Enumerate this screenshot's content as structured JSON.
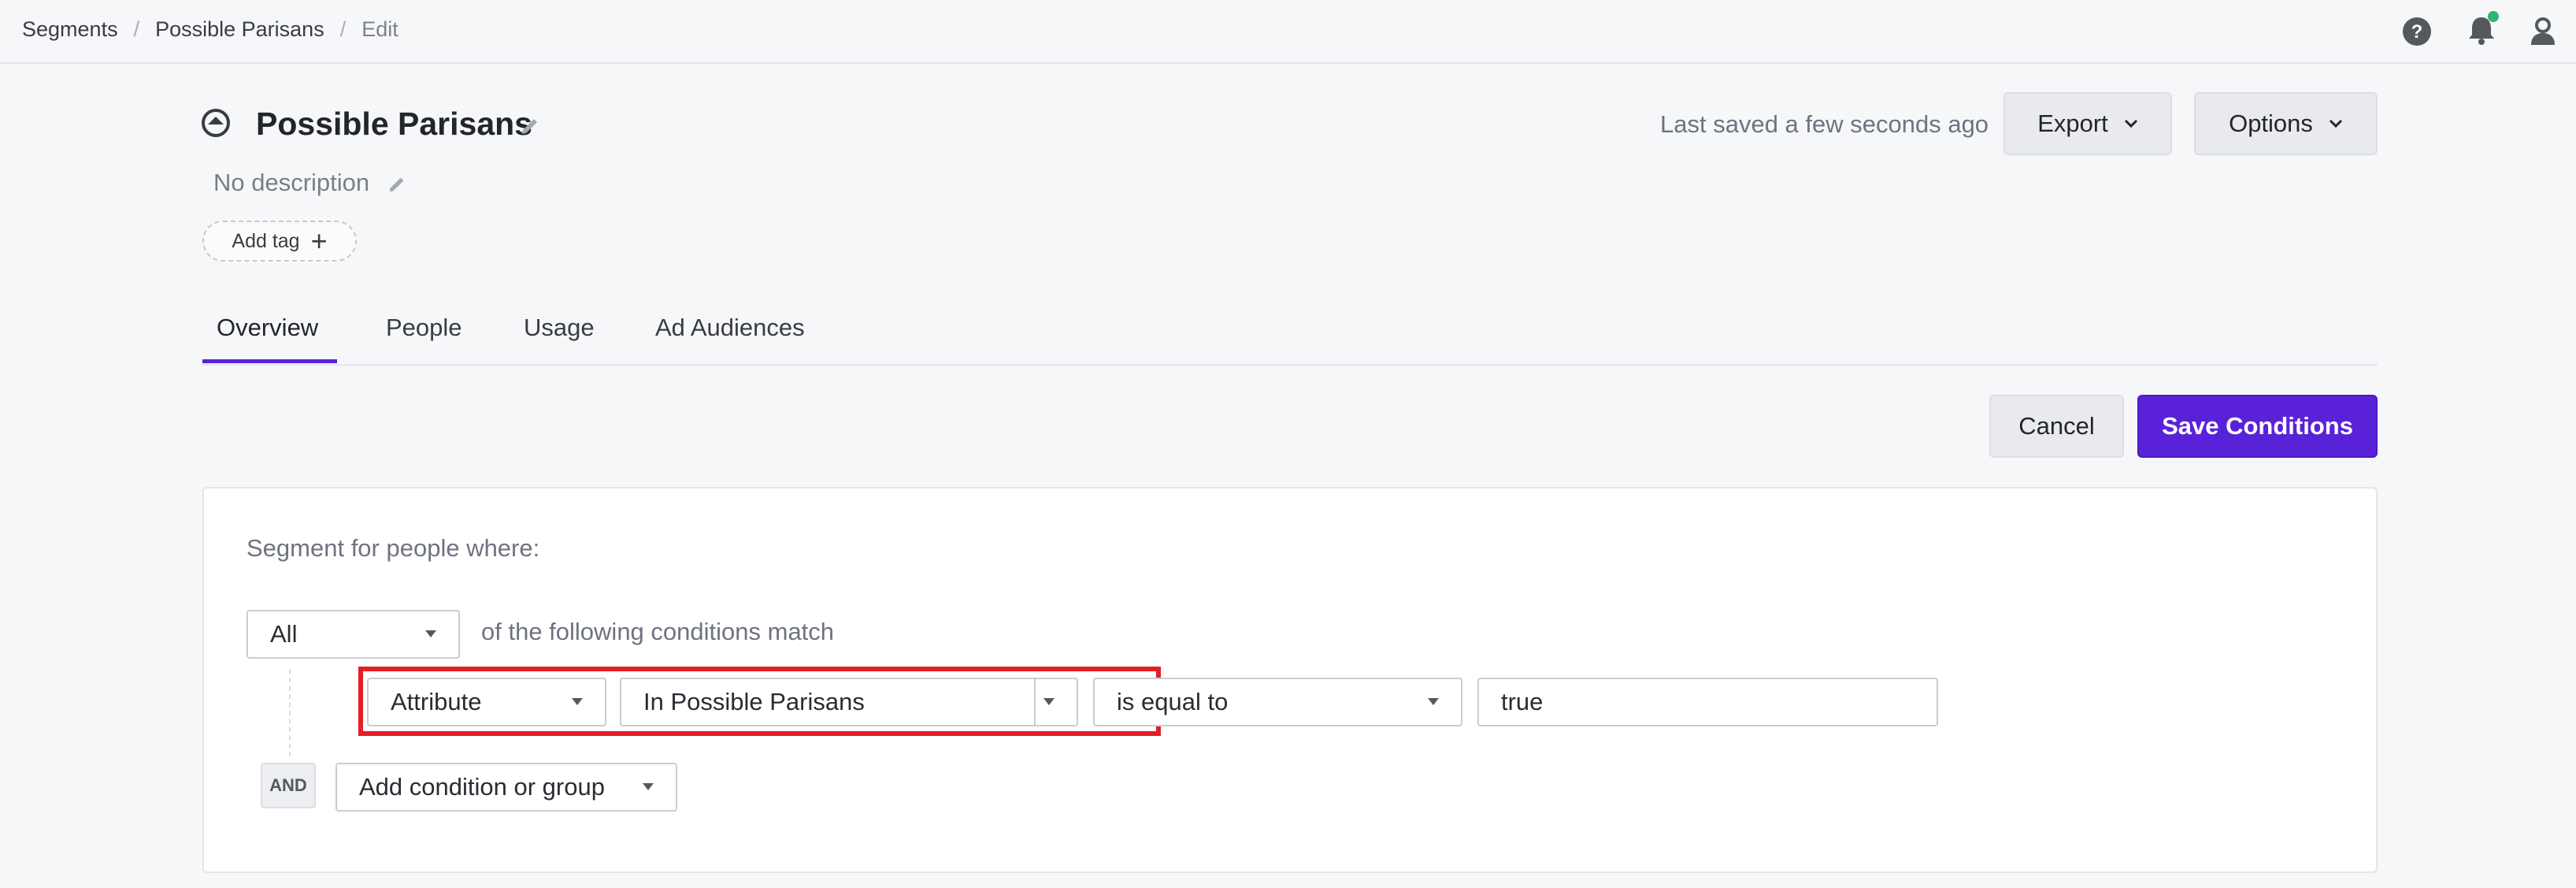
{
  "breadcrumb": {
    "items": [
      "Segments",
      "Possible Parisans"
    ],
    "separator": "/",
    "current": "Edit"
  },
  "top_icons": [
    "help-icon",
    "bell-icon",
    "user-icon"
  ],
  "notification_dot_color": "#2bb673",
  "segment": {
    "icon": "segment-icon",
    "title": "Possible Parisans",
    "description": "No description",
    "add_tag_label": "Add tag"
  },
  "header": {
    "last_saved": "Last saved a few seconds ago",
    "export_label": "Export",
    "options_label": "Options"
  },
  "tabs": [
    {
      "label": "Overview",
      "active": true
    },
    {
      "label": "People",
      "active": false
    },
    {
      "label": "Usage",
      "active": false
    },
    {
      "label": "Ad Audiences",
      "active": false
    }
  ],
  "actions": {
    "cancel_label": "Cancel",
    "save_label": "Save Conditions"
  },
  "accent_color": "#5a22d8",
  "highlight_color": "#e31e24",
  "conditions": {
    "heading": "Segment for people where:",
    "match_mode": "All",
    "match_text": "of the following conditions match",
    "rule": {
      "type": "Attribute",
      "property": "In Possible Parisans",
      "operator": "is equal to",
      "value": "true"
    },
    "and_label": "AND",
    "add_condition_label": "Add condition or group"
  }
}
